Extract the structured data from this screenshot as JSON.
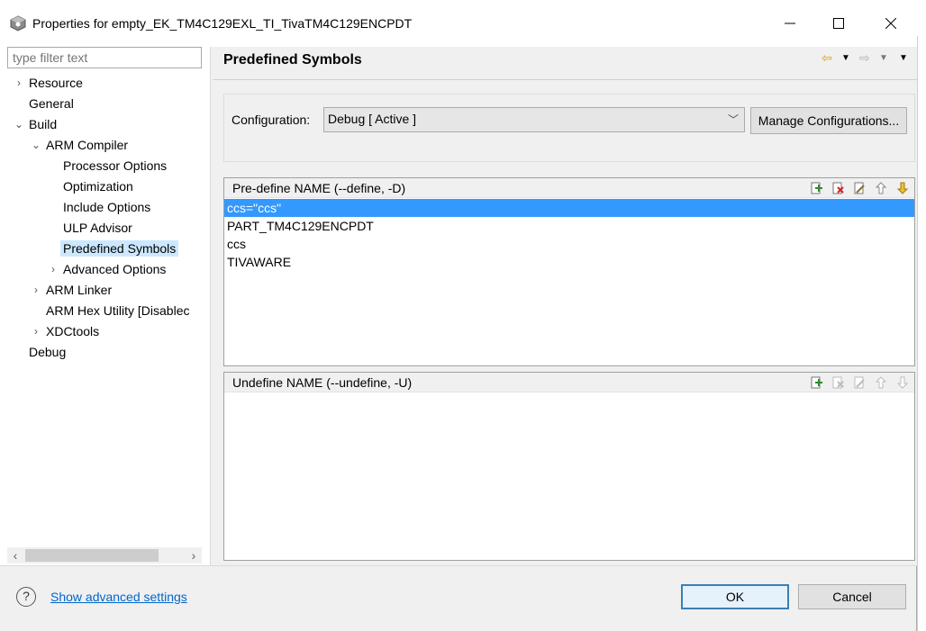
{
  "window": {
    "title": "Properties for empty_EK_TM4C129EXL_TI_TivaTM4C129ENCPDT"
  },
  "filter": {
    "placeholder": "type filter text"
  },
  "tree": {
    "resource": "Resource",
    "general": "General",
    "build": "Build",
    "arm_compiler": "ARM Compiler",
    "processor_options": "Processor Options",
    "optimization": "Optimization",
    "include_options": "Include Options",
    "ulp_advisor": "ULP Advisor",
    "predefined_symbols": "Predefined Symbols",
    "advanced_options": "Advanced Options",
    "arm_linker": "ARM Linker",
    "arm_hex_utility": "ARM Hex Utility  [Disablec",
    "xdctools": "XDCtools",
    "debug": "Debug"
  },
  "page": {
    "title": "Predefined Symbols"
  },
  "configuration": {
    "label": "Configuration:",
    "value": "Debug  [ Active ]",
    "manage_label": "Manage Configurations..."
  },
  "predefine": {
    "header": "Pre-define NAME (--define, -D)",
    "items": [
      "ccs=\"ccs\"",
      "PART_TM4C129ENCPDT",
      "ccs",
      "TIVAWARE"
    ]
  },
  "undefine": {
    "header": "Undefine NAME (--undefine, -U)"
  },
  "footer": {
    "advanced_link": "Show advanced settings",
    "ok_label": "OK",
    "cancel_label": "Cancel"
  },
  "colors": {
    "selection": "#3399ff",
    "tree_selection": "#cce8ff",
    "link": "#0066cc"
  }
}
